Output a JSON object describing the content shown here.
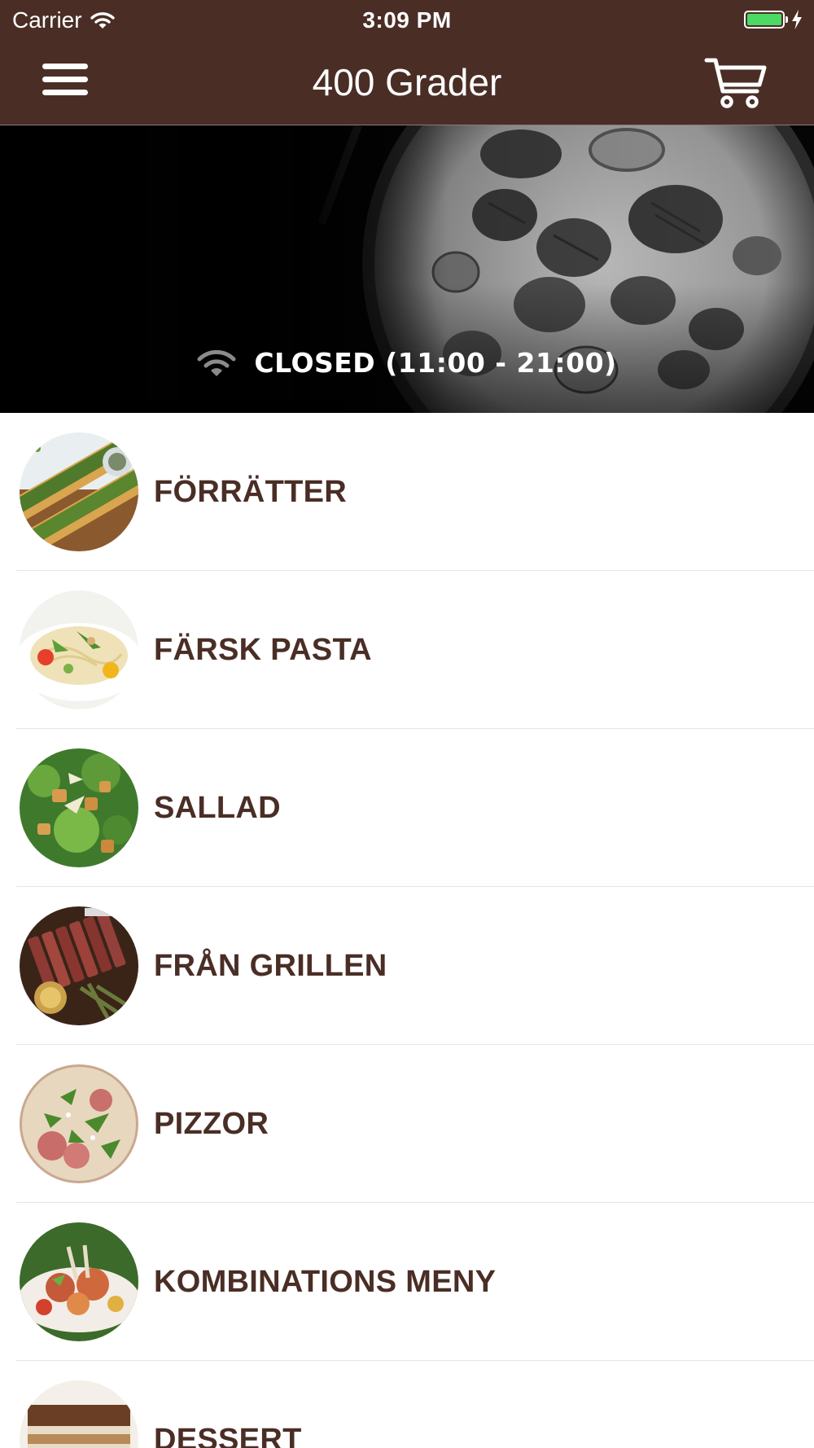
{
  "status_bar": {
    "carrier": "Carrier",
    "time": "3:09 PM",
    "battery_percent": 100
  },
  "nav": {
    "title": "400 Grader"
  },
  "hero": {
    "status_text": "CLOSED (11:00 - 21:00)"
  },
  "categories": [
    {
      "label": "FÖRRÄTTER"
    },
    {
      "label": "FÄRSK PASTA"
    },
    {
      "label": "SALLAD"
    },
    {
      "label": "FRÅN GRILLEN"
    },
    {
      "label": "PIZZOR"
    },
    {
      "label": "KOMBINATIONS MENY"
    },
    {
      "label": "DESSERT"
    }
  ],
  "colors": {
    "nav_background": "#4a2e26",
    "label_text": "#4a2e26",
    "battery_fill": "#4cd964",
    "divider": "#e4e4e4"
  }
}
